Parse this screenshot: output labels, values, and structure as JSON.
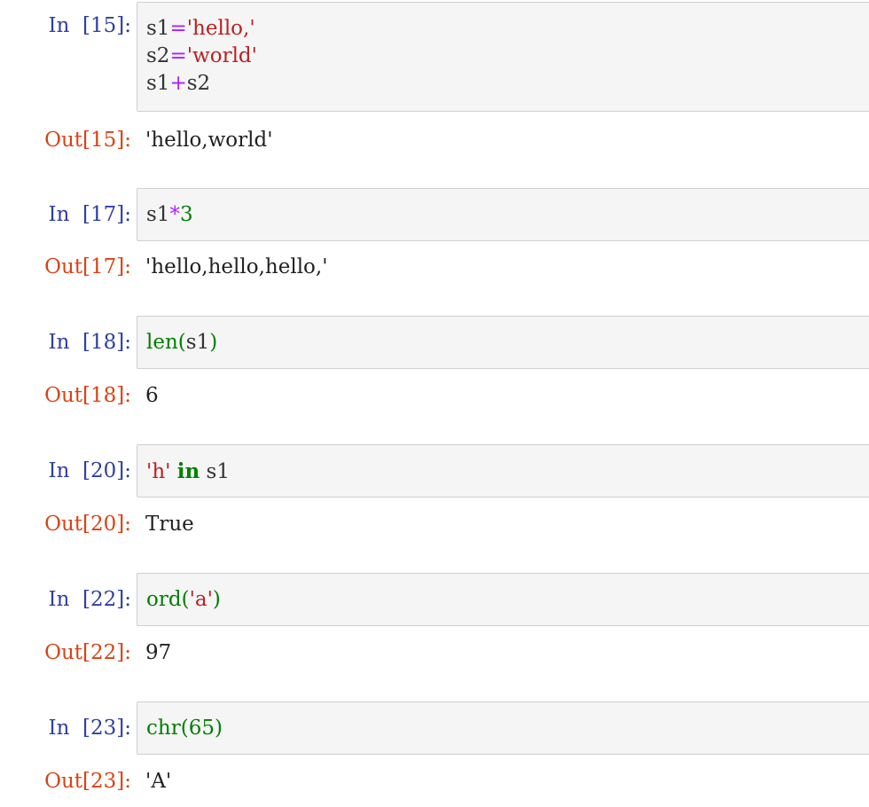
{
  "cells": [
    {
      "in_prompt": "In  [15]:",
      "out_prompt": "Out[15]:",
      "code_lines": [
        [
          {
            "t": "s1",
            "c": "n"
          },
          {
            "t": "=",
            "c": "o"
          },
          {
            "t": "'hello,'",
            "c": "s"
          }
        ],
        [
          {
            "t": "s2",
            "c": "n"
          },
          {
            "t": "=",
            "c": "o"
          },
          {
            "t": "'world'",
            "c": "s"
          }
        ],
        [
          {
            "t": "s1",
            "c": "n"
          },
          {
            "t": "+",
            "c": "o"
          },
          {
            "t": "s2",
            "c": "n"
          }
        ]
      ],
      "output": "'hello,world'"
    },
    {
      "in_prompt": "In  [17]:",
      "out_prompt": "Out[17]:",
      "code_lines": [
        [
          {
            "t": "s1",
            "c": "n"
          },
          {
            "t": "*",
            "c": "o"
          },
          {
            "t": "3",
            "c": "m"
          }
        ]
      ],
      "output": "'hello,hello,hello,'"
    },
    {
      "in_prompt": "In  [18]:",
      "out_prompt": "Out[18]:",
      "code_lines": [
        [
          {
            "t": "len",
            "c": "b"
          },
          {
            "t": "(",
            "c": "b"
          },
          {
            "t": "s1",
            "c": "n"
          },
          {
            "t": ")",
            "c": "b"
          }
        ]
      ],
      "output": "6"
    },
    {
      "in_prompt": "In  [20]:",
      "out_prompt": "Out[20]:",
      "code_lines": [
        [
          {
            "t": "'h'",
            "c": "s"
          },
          {
            "t": " ",
            "c": "n"
          },
          {
            "t": "in",
            "c": "k"
          },
          {
            "t": " s1",
            "c": "n"
          }
        ]
      ],
      "output": "True"
    },
    {
      "in_prompt": "In  [22]:",
      "out_prompt": "Out[22]:",
      "code_lines": [
        [
          {
            "t": "ord",
            "c": "b"
          },
          {
            "t": "(",
            "c": "b"
          },
          {
            "t": "'a'",
            "c": "s"
          },
          {
            "t": ")",
            "c": "b"
          }
        ]
      ],
      "output": "97"
    },
    {
      "in_prompt": "In  [23]:",
      "out_prompt": "Out[23]:",
      "code_lines": [
        [
          {
            "t": "chr",
            "c": "b"
          },
          {
            "t": "(",
            "c": "b"
          },
          {
            "t": "65",
            "c": "m"
          },
          {
            "t": ")",
            "c": "b"
          }
        ]
      ],
      "output": "'A'"
    }
  ]
}
